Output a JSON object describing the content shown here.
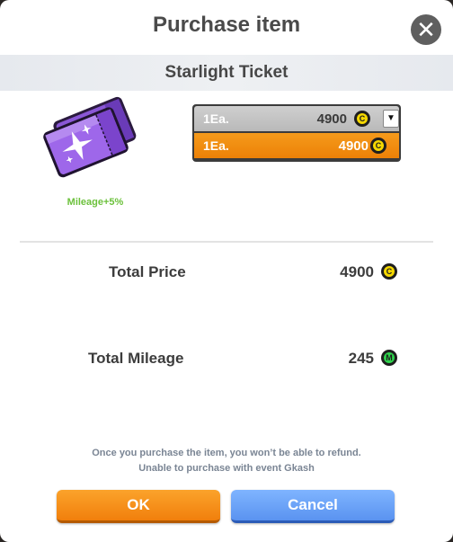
{
  "dialog": {
    "title": "Purchase item",
    "close_icon": "close-icon"
  },
  "item": {
    "name": "Starlight Ticket",
    "mileage_bonus": "Mileage+5%",
    "icon": "ticket-icon"
  },
  "quantity_dropdown": {
    "selected": {
      "qty": "1Ea.",
      "price": "4900",
      "currency": "C"
    },
    "options": [
      {
        "qty": "1Ea.",
        "price": "4900",
        "currency": "C"
      }
    ],
    "arrow_icon": "chevron-down-icon"
  },
  "summary": {
    "total_price_label": "Total Price",
    "total_price_value": "4900",
    "total_price_currency": "C",
    "total_mileage_label": "Total Mileage",
    "total_mileage_value": "245",
    "total_mileage_currency": "M"
  },
  "notice": {
    "line1": "Once you purchase the item, you won’t be able to refund.",
    "line2": "Unable to purchase with event Gkash"
  },
  "buttons": {
    "ok": "OK",
    "cancel": "Cancel"
  },
  "colors": {
    "accent_orange": "#f17f0c",
    "cancel_blue": "#5a93f0",
    "mileage_green": "#6cc13c",
    "coin_yellow": "#f5d800",
    "mileage_coin_green": "#2fd34d"
  }
}
